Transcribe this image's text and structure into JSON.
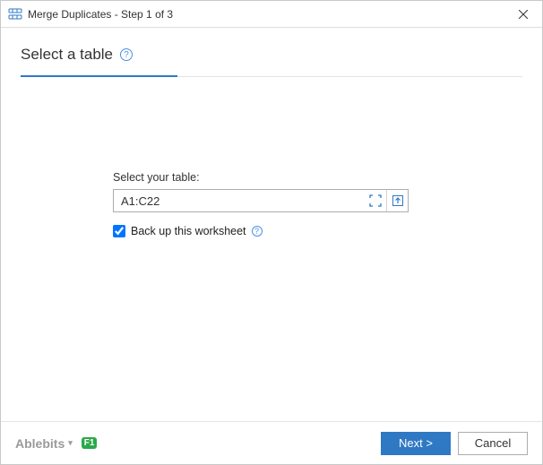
{
  "titlebar": {
    "title": "Merge Duplicates - Step 1 of 3"
  },
  "header": {
    "title": "Select a table"
  },
  "form": {
    "label": "Select your table:",
    "range_value": "A1:C22",
    "backup_label": "Back up this worksheet",
    "backup_checked": true
  },
  "footer": {
    "brand": "Ablebits",
    "help_key": "F1",
    "next_label": "Next >",
    "cancel_label": "Cancel"
  }
}
